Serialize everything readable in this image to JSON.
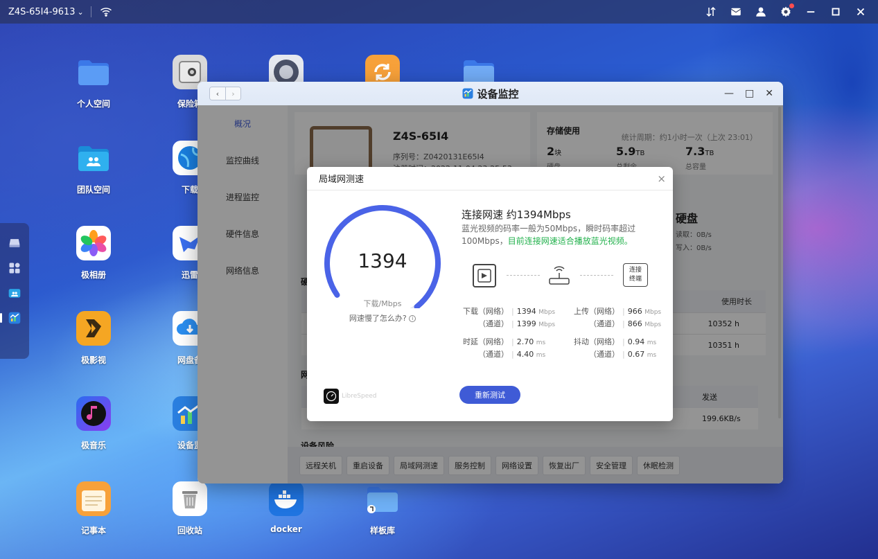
{
  "topbar": {
    "hostname": "Z4S-65I4-9613",
    "chevron": "⌄",
    "icons": [
      "sort-icon",
      "mail-icon",
      "user-icon",
      "gear-icon",
      "minimize-icon",
      "maximize-icon",
      "close-icon"
    ],
    "accent_dot": "#ff4d4f"
  },
  "dock": [
    "drive-icon",
    "apps-grid-icon",
    "team-space-icon",
    "device-monitor-icon"
  ],
  "desktop": {
    "apps": [
      {
        "label": "个人空间",
        "icon": "folder-icon"
      },
      {
        "label": "保险箱",
        "icon": "safe-icon"
      },
      {
        "label": "团队空间",
        "icon": "team-folder-icon"
      },
      {
        "label": "下载",
        "icon": "globe-download-icon"
      },
      {
        "label": "极相册",
        "icon": "photos-icon"
      },
      {
        "label": "迅雷",
        "icon": "thunder-icon"
      },
      {
        "label": "极影视",
        "icon": "video-icon"
      },
      {
        "label": "网盘备",
        "icon": "cloud-backup-icon"
      },
      {
        "label": "极音乐",
        "icon": "music-icon"
      },
      {
        "label": "设备监",
        "icon": "device-monitor-icon"
      },
      {
        "label": "记事本",
        "icon": "notepad-icon"
      },
      {
        "label": "回收站",
        "icon": "trash-icon"
      },
      {
        "label": "docker",
        "icon": "docker-icon"
      },
      {
        "label": "样板库",
        "icon": "template-folder-icon"
      }
    ]
  },
  "window": {
    "title": "设备监控",
    "nav_back": "‹",
    "nav_forward": "›",
    "controls": {
      "minimize": "—",
      "maximize": "□",
      "close": "✕"
    },
    "sidebar": [
      {
        "label": "概况",
        "active": true
      },
      {
        "label": "监控曲线",
        "active": false
      },
      {
        "label": "进程监控",
        "active": false
      },
      {
        "label": "硬件信息",
        "active": false
      },
      {
        "label": "网络信息",
        "active": false
      }
    ],
    "device": {
      "name": "Z4S-65I4",
      "serial": "序列号：Z0420131E65I4",
      "registered": "注册时间：2022-11-04 23:25:53"
    },
    "storage": {
      "title": "存储使用",
      "period": "统计周期：约1小时一次（上次 23:01）",
      "values": [
        {
          "value": "2",
          "unit": "块",
          "label": "硬盘"
        },
        {
          "value": "5.9",
          "unit": "TB",
          "label": "总剩余"
        },
        {
          "value": "7.3",
          "unit": "TB",
          "label": "总容量"
        }
      ]
    },
    "disk": {
      "title": "硬盘",
      "read": "读取：0B/s",
      "write": "写入：0B/s"
    },
    "section_hardware": "硬",
    "section_network": "网",
    "table": {
      "header": "使用时长",
      "rows": [
        "10352 h",
        "10351 h"
      ]
    },
    "net_table": {
      "header": "发送",
      "row": "199.6KB/s"
    },
    "section_risk": "设备风险",
    "actions": [
      "远程关机",
      "重启设备",
      "局域网测速",
      "服务控制",
      "网络设置",
      "恢复出厂",
      "安全管理",
      "休眠检测"
    ]
  },
  "dialog": {
    "title": "局域网测速",
    "close": "×",
    "gauge_value": "1394",
    "gauge_unit": "下载/Mbps",
    "gauge_fraction": 0.92,
    "gauge_color": "#4a63e7",
    "slow_help": "网速慢了怎么办?",
    "result_title": "连接网速 约1394Mbps",
    "result_desc": "蓝光视频的码率一般为50Mbps，瞬时码率超过100Mbps，",
    "result_desc_green": "目前连接网速适合播放蓝光视频。",
    "endpoint_label": "连接\n终端",
    "stats": {
      "download": {
        "key_net": "下载（网络）",
        "val_net": "1394",
        "key_ch": "（通道）",
        "val_ch": "1399",
        "unit": "Mbps"
      },
      "upload": {
        "key_net": "上传（网络）",
        "val_net": "966",
        "key_ch": "（通道）",
        "val_ch": "866",
        "unit": "Mbps"
      },
      "latency": {
        "key_net": "时延（网络）",
        "val_net": "2.70",
        "key_ch": "（通道）",
        "val_ch": "4.40",
        "unit": "ms"
      },
      "jitter": {
        "key_net": "抖动（网络）",
        "val_net": "0.94",
        "key_ch": "（通道）",
        "val_ch": "0.67",
        "unit": "ms"
      }
    },
    "librespeed": "LibreSpeed",
    "retest": "重新测试",
    "accent": "#3f5bd6"
  }
}
